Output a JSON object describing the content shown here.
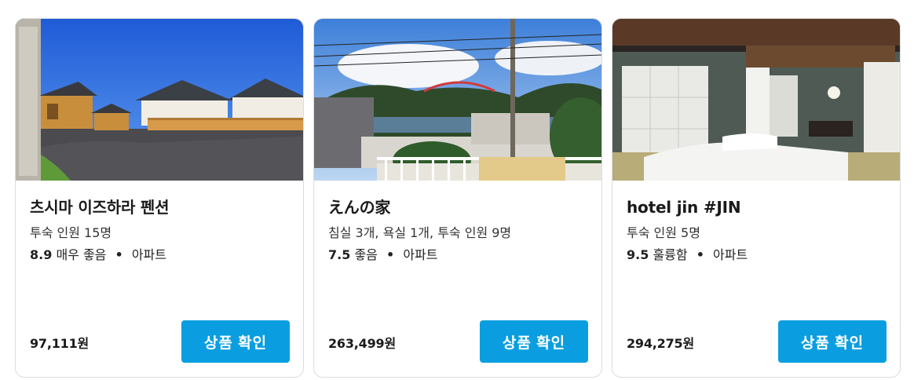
{
  "listings": [
    {
      "title": "츠시마 이즈하라 펜션",
      "details": "투숙 인원 15명",
      "score": "8.9",
      "score_label": "매우 좋음",
      "separator": "•",
      "type": "아파트",
      "price": "97,111원",
      "cta": "상품 확인",
      "image": "pension-cabins-photo"
    },
    {
      "title": "えんの家",
      "details": "침실 3개, 욕실 1개, 투숙 인원 9명",
      "score": "7.5",
      "score_label": "좋음",
      "separator": "•",
      "type": "아파트",
      "price": "263,499원",
      "cta": "상품 확인",
      "image": "harbor-view-photo"
    },
    {
      "title": "hotel jin #JIN",
      "details": "투숙 인원 5명",
      "score": "9.5",
      "score_label": "훌륭함",
      "separator": "•",
      "type": "아파트",
      "price": "294,275원",
      "cta": "상품 확인",
      "image": "japanese-room-photo"
    }
  ],
  "colors": {
    "button": "#0a9ee0",
    "button_text": "#ffffff",
    "card_border": "#dcdcdc"
  }
}
